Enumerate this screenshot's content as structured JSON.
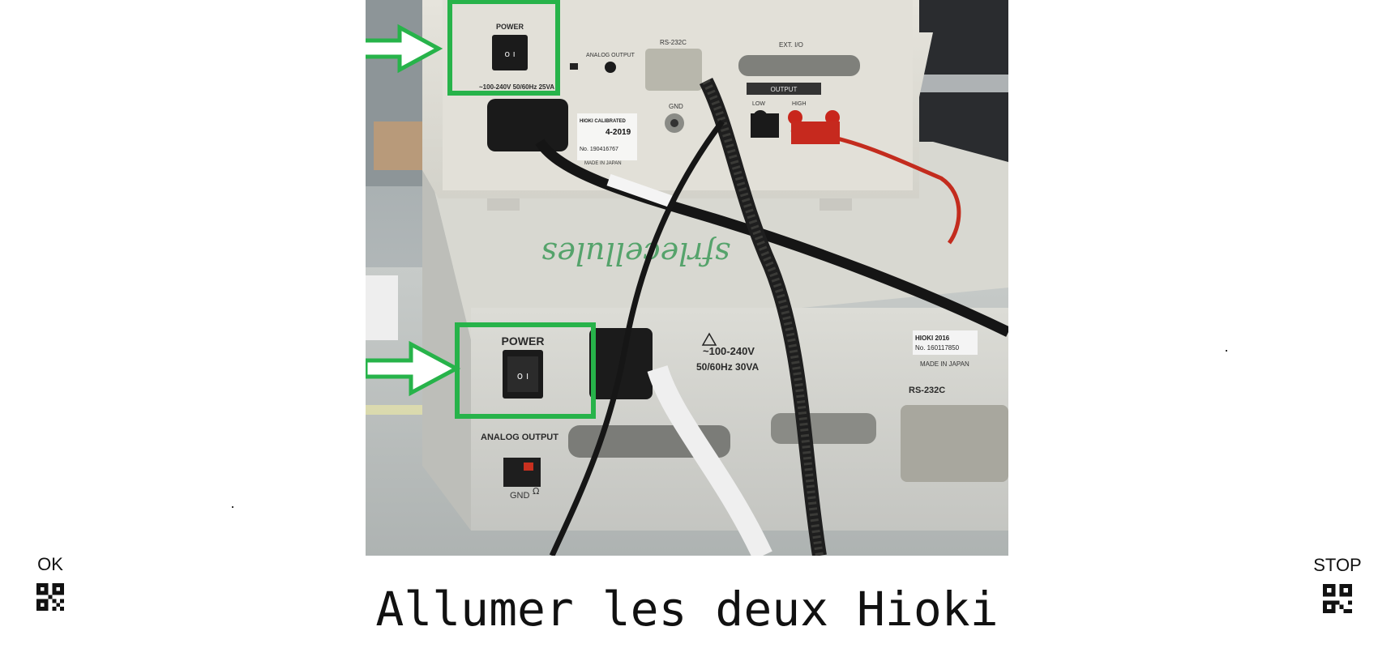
{
  "photo": {
    "upper_device": {
      "power_label": "POWER",
      "voltage_label": "~100-240V 50/60Hz 25VA",
      "serial_port_label": "RS-232C",
      "ext_io_label": "EXT. I/O",
      "analog_output_label": "ANALOG OUTPUT",
      "output_label": "OUTPUT",
      "low_label": "LOW",
      "high_label": "HIGH",
      "gnd_label": "GND",
      "calibration_label": "HIOKI CALIBRATED",
      "calibration_date": "4-2019",
      "serial_number": "No. 190416767",
      "made_in": "MADE IN JAPAN"
    },
    "lower_device": {
      "power_label": "POWER",
      "voltage_label": "~100-240V",
      "frequency_label": "50/60Hz 30VA",
      "analog_output_label": "ANALOG OUTPUT",
      "gnd_label": "GND",
      "ohm_label": "Ω",
      "serial_port_label": "RS-232C",
      "brand_year": "HIOKI 2016",
      "serial_number": "No. 160117850",
      "made_in": "MADE IN JAPAN"
    },
    "highlight_color": "#27b34a"
  },
  "controls": {
    "ok_label": "OK",
    "stop_label": "STOP",
    "ok_icon": "qr-code-icon",
    "stop_icon": "qr-code-icon"
  },
  "instruction": "Allumer les deux Hioki"
}
